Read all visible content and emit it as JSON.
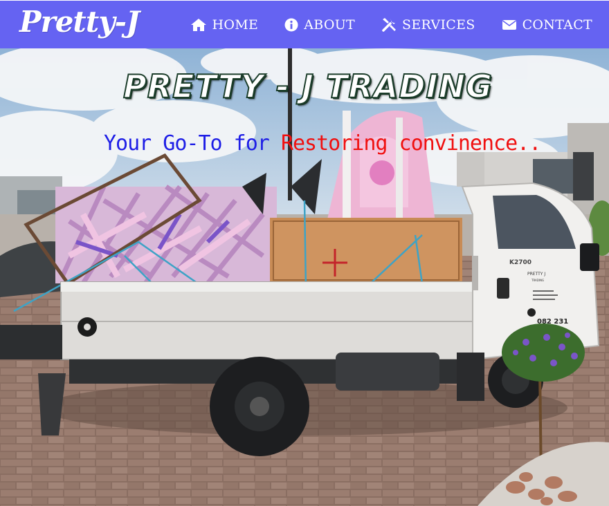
{
  "brand": {
    "logo_text": "Pretty-J",
    "nav_bg": "#6563f2"
  },
  "nav": {
    "items": [
      {
        "label": "HOME",
        "icon": "home-icon"
      },
      {
        "label": "ABOUT",
        "icon": "info-icon"
      },
      {
        "label": "SERVICES",
        "icon": "tools-icon"
      },
      {
        "label": "CONTACT",
        "icon": "envelope-icon"
      }
    ]
  },
  "hero": {
    "title": "PRETTY - J TRADING",
    "tagline_part1": "Your Go-To for",
    "tagline_part2": "Restoring convinence..",
    "tagline_color1": "#1e1ee6",
    "tagline_color2": "#f01010",
    "truck_door_brand": "PRETTY J",
    "truck_door_sub": "TRADING",
    "truck_model": "K2700",
    "truck_phone": "082 231"
  }
}
